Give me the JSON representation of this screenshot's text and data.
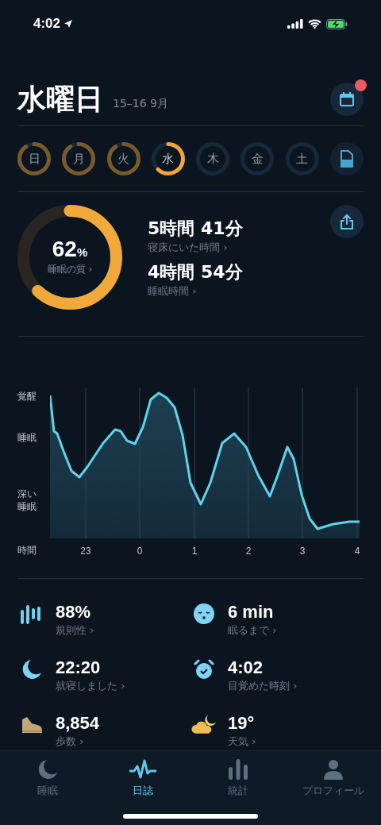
{
  "status_bar": {
    "time": "4:02"
  },
  "header": {
    "title": "水曜日",
    "date_range": "15–16 9月",
    "calendar_badge": true
  },
  "days": [
    {
      "label": "日",
      "kind": "recorded",
      "selected": false
    },
    {
      "label": "月",
      "kind": "recorded",
      "selected": false
    },
    {
      "label": "火",
      "kind": "recorded",
      "selected": false
    },
    {
      "label": "水",
      "kind": "recorded",
      "selected": true
    },
    {
      "label": "木",
      "kind": "empty",
      "selected": false
    },
    {
      "label": "金",
      "kind": "empty",
      "selected": false
    },
    {
      "label": "土",
      "kind": "empty",
      "selected": false
    }
  ],
  "summary": {
    "quality": {
      "value": "62",
      "unit": "%",
      "label": "睡眠の質 ›",
      "level": 0.62
    },
    "durations": [
      {
        "value": "5時間 41分",
        "label": "寝床にいた時間 ›"
      },
      {
        "value": "4時間 54分",
        "label": "睡眠時間 ›"
      }
    ]
  },
  "sleep_graph": {
    "y_labels": [
      "覚醒",
      "睡眠",
      "深い睡眠"
    ],
    "x_title": "時間",
    "x_labels": [
      "23",
      "0",
      "1",
      "2",
      "3",
      "4"
    ]
  },
  "stats": [
    {
      "kind": "regularity",
      "value": "88%",
      "label": "規則性 ›"
    },
    {
      "kind": "asleep",
      "value": "6 min",
      "label": "眠るまで ›"
    },
    {
      "kind": "bedtime",
      "value": "22:20",
      "label": "就寝しました ›"
    },
    {
      "kind": "wake",
      "value": "4:02",
      "label": "目覚めた時刻 ›"
    },
    {
      "kind": "steps",
      "value": "8,854",
      "label": "歩数 ›"
    },
    {
      "kind": "weather",
      "value": "19°",
      "label": "天気 ›"
    }
  ],
  "tabs": [
    {
      "kind": "sleep",
      "label": "睡眠",
      "selected": false
    },
    {
      "kind": "journal",
      "label": "日誌",
      "selected": true
    },
    {
      "kind": "stats",
      "label": "統計",
      "selected": false
    },
    {
      "kind": "profile",
      "label": "プロフィール",
      "selected": false
    }
  ]
}
